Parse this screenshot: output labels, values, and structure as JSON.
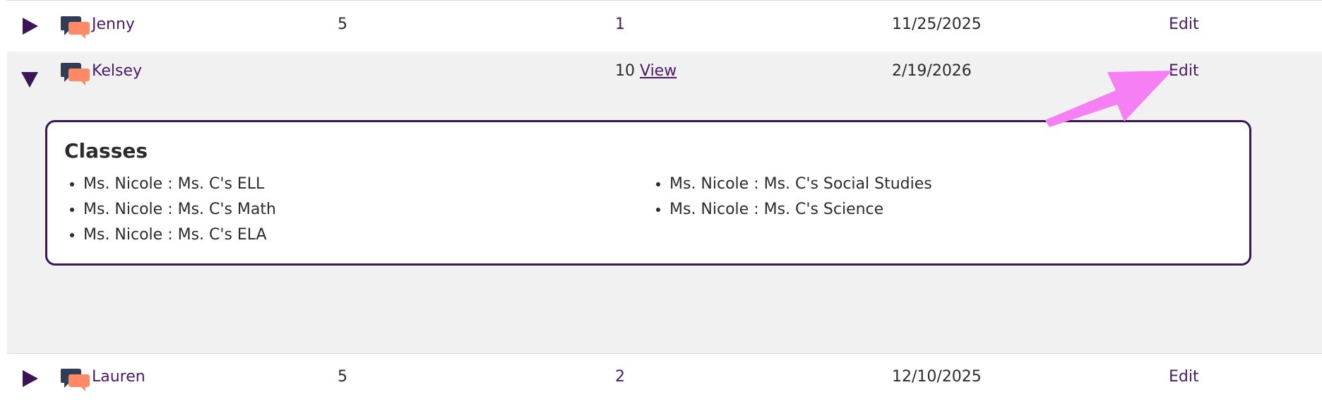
{
  "rows": [
    {
      "name": "Jenny",
      "col_a": "5",
      "col_b": "1",
      "date": "11/25/2025",
      "edit": "Edit",
      "expanded": false
    },
    {
      "name": "Kelsey",
      "col_b": "10",
      "view": "View",
      "date": "2/19/2026",
      "edit": "Edit",
      "expanded": true,
      "details": {
        "title": "Classes",
        "left_items": [
          "Ms. Nicole : Ms. C's ELL",
          "Ms. Nicole : Ms. C's Math",
          "Ms. Nicole : Ms. C's ELA"
        ],
        "right_items": [
          "Ms. Nicole : Ms. C's Social Studies",
          "Ms. Nicole : Ms. C's Science"
        ]
      }
    },
    {
      "name": "Lauren",
      "col_a": "5",
      "col_b": "2",
      "date": "12/10/2025",
      "edit": "Edit",
      "expanded": false
    }
  ],
  "icons": {
    "toggle_collapsed": "triangle-right-icon",
    "toggle_expanded": "triangle-down-icon",
    "chat": "chat-bubbles-icon",
    "annotation": "arrow-annotation"
  },
  "colors": {
    "accent_purple": "#4a1a66",
    "chat_dark": "#2f3e56",
    "chat_orange": "#ff8a65",
    "annotation_pink": "#f77ff4",
    "expanded_row_bg": "#f1f1f1"
  }
}
